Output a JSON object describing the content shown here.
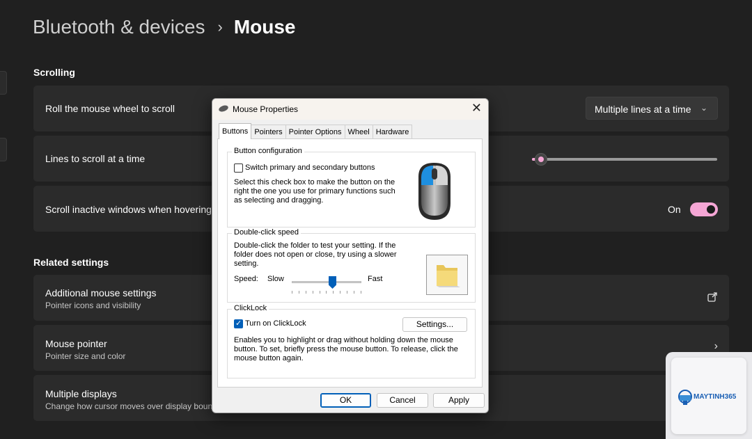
{
  "header": {
    "parent": "Bluetooth & devices",
    "separator": "›",
    "current": "Mouse"
  },
  "scrolling": {
    "title": "Scrolling",
    "roll": {
      "label": "Roll the mouse wheel to scroll",
      "value": "Multiple lines at a time"
    },
    "lines": {
      "label": "Lines to scroll at a time",
      "level": 0.05
    },
    "inactive": {
      "label": "Scroll inactive windows when hovering over them",
      "state": "On"
    }
  },
  "related": {
    "title": "Related settings",
    "items": [
      {
        "title": "Additional mouse settings",
        "subtitle": "Pointer icons and visibility"
      },
      {
        "title": "Mouse pointer",
        "subtitle": "Pointer size and color"
      },
      {
        "title": "Multiple displays",
        "subtitle": "Change how cursor moves over display boundaries"
      }
    ]
  },
  "dialog": {
    "title": "Mouse Properties",
    "tabs": [
      "Buttons",
      "Pointers",
      "Pointer Options",
      "Wheel",
      "Hardware"
    ],
    "button_config": {
      "label": "Button configuration",
      "checkbox": "Switch primary and secondary buttons",
      "desc": "Select this check box to make the button on the right the one you use for primary functions such as selecting and dragging."
    },
    "double_click": {
      "label": "Double-click speed",
      "desc": "Double-click the folder to test your setting. If the folder does not open or close, try using a slower setting.",
      "speed_label": "Speed:",
      "slow": "Slow",
      "fast": "Fast",
      "level": 0.58
    },
    "clicklock": {
      "label": "ClickLock",
      "checkbox": "Turn on ClickLock",
      "settings": "Settings...",
      "desc": "Enables you to highlight or drag without holding down the mouse button. To set, briefly press the mouse button. To release, click the mouse button again."
    },
    "buttons": {
      "ok": "OK",
      "cancel": "Cancel",
      "apply": "Apply"
    }
  },
  "watermark": {
    "brand": "MAYTINH365"
  },
  "colors": {
    "accent": "#f5a6d5",
    "dialog_accent": "#005fb8",
    "background": "#202020",
    "card": "#2b2b2b"
  }
}
